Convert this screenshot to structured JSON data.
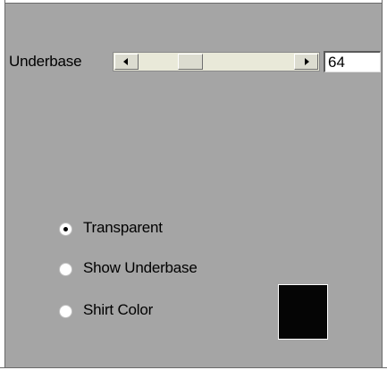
{
  "underbase": {
    "label": "Underbase",
    "value": "64",
    "slider_fraction": 0.3
  },
  "options": [
    {
      "label": "Transparent",
      "selected": true
    },
    {
      "label": "Show Underbase",
      "selected": false
    },
    {
      "label": "Shirt Color",
      "selected": false
    }
  ],
  "shirt_color": {
    "swatch_color": "#050505",
    "icon": "color-swatch"
  },
  "colors": {
    "panel_background": "#a5a5a5",
    "track": "#e9e9d9"
  }
}
